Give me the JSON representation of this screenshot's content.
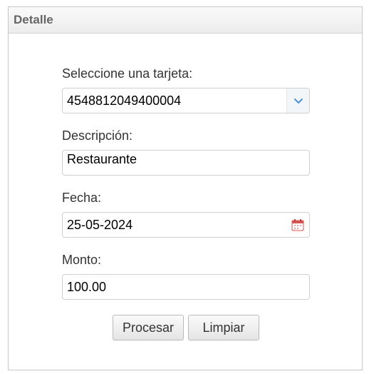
{
  "panel": {
    "title": "Detalle"
  },
  "form": {
    "card_label": "Seleccione una tarjeta:",
    "card_value": "4548812049400004",
    "description_label": "Descripción:",
    "description_value": "Restaurante",
    "date_label": "Fecha:",
    "date_value": "25-05-2024",
    "amount_label": "Monto:",
    "amount_value": "100.00"
  },
  "actions": {
    "process_label": "Procesar",
    "clear_label": "Limpiar"
  },
  "icons": {
    "select_trigger": "chevron-down-icon",
    "date_picker": "calendar-icon"
  },
  "colors": {
    "chevron": "#4a90d9",
    "calendar": "#d9534f"
  }
}
